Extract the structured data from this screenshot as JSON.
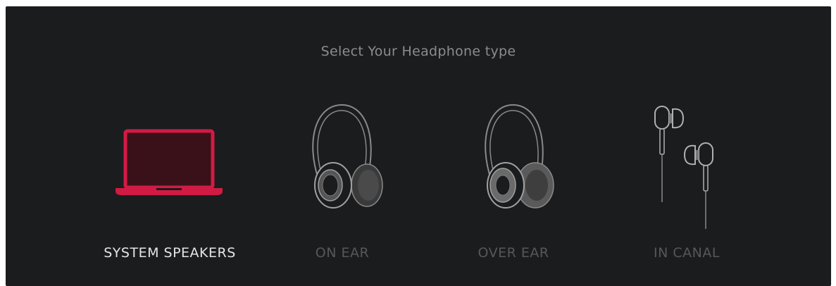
{
  "header": {
    "title": "Select Your Headphone type"
  },
  "options": [
    {
      "label": "SYSTEM SPEAKERS",
      "icon": "laptop-icon",
      "selected": true
    },
    {
      "label": "ON EAR",
      "icon": "on-ear-headphones-icon",
      "selected": false
    },
    {
      "label": "OVER EAR",
      "icon": "over-ear-headphones-icon",
      "selected": false
    },
    {
      "label": "IN CANAL",
      "icon": "earbuds-icon",
      "selected": false
    }
  ],
  "colors": {
    "background": "#1b1c1e",
    "accent": "#d11b45",
    "selected_label": "#e4e5e7",
    "unselected_label": "#55575b",
    "title": "#8a8c90"
  }
}
